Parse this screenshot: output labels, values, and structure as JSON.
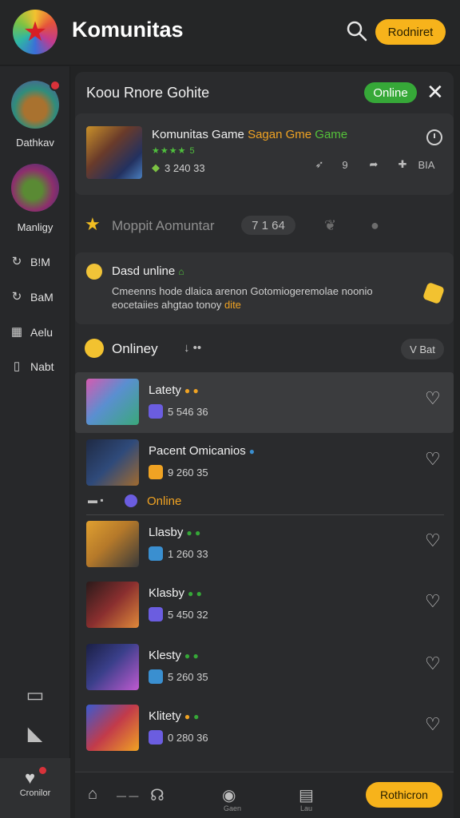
{
  "app": {
    "title": "Komunitas",
    "cta_label": "Rodniret",
    "accent": "#f7b31b"
  },
  "sidebar": {
    "avatars": [
      {
        "label": "Dathkav"
      },
      {
        "label": "Manligy"
      }
    ],
    "items": [
      {
        "icon": "refresh-icon",
        "label": "B!M"
      },
      {
        "icon": "refresh-icon",
        "label": "BaM"
      },
      {
        "icon": "grid-icon",
        "label": "Aelu"
      },
      {
        "icon": "document-icon",
        "label": "Nabt"
      }
    ],
    "footer_label": "Cronilor"
  },
  "panel": {
    "title": "Koou Rnore Gohite",
    "status": "Online",
    "featured": {
      "title_main": "Komunitas Game",
      "title_accent": "Sagan Gme",
      "title_green": "Game",
      "stars": "★★★★ 5",
      "count": "3 240 33",
      "action_count_1": "9",
      "action_count_2": "BIA"
    },
    "section": {
      "title": "Moppit Aomuntar",
      "count": "7 1 64"
    },
    "notice": {
      "title": "Dasd unline",
      "body_line1": "Cmeenns hode dlaica arenon Gotomiogeremolae noonio",
      "body_line2": "eocetaiies ahgtao tonoy",
      "body_accent": "dite"
    },
    "list": {
      "title": "Onliney",
      "sort_label": "V Bat",
      "divider_label": "Online",
      "items": [
        {
          "name": "Latety",
          "count": "5 546 36",
          "thumb_color": "#5a8fd0",
          "chip_color": "#6b5de0"
        },
        {
          "name": "Pacent Omicanios",
          "count": "9 260 35",
          "thumb_color": "#2f4a7a",
          "chip_color": "#f0a323"
        },
        {
          "name": "Llasby",
          "count": "1 260 33",
          "thumb_color": "#b5792a",
          "chip_color": "#3a8fd0"
        },
        {
          "name": "Klasby",
          "count": "5 450 32",
          "thumb_color": "#8a2f2f",
          "chip_color": "#6b5de0"
        },
        {
          "name": "Klesty",
          "count": "5 260 35",
          "thumb_color": "#3a3f8a",
          "chip_color": "#3a8fd0"
        },
        {
          "name": "Klitety",
          "count": "0 280 36",
          "thumb_color": "#c23b4a",
          "chip_color": "#6b5de0"
        }
      ]
    }
  },
  "bottombar": {
    "cta_label": "Rothicron",
    "captions": [
      "Gaen",
      "Lau"
    ]
  }
}
